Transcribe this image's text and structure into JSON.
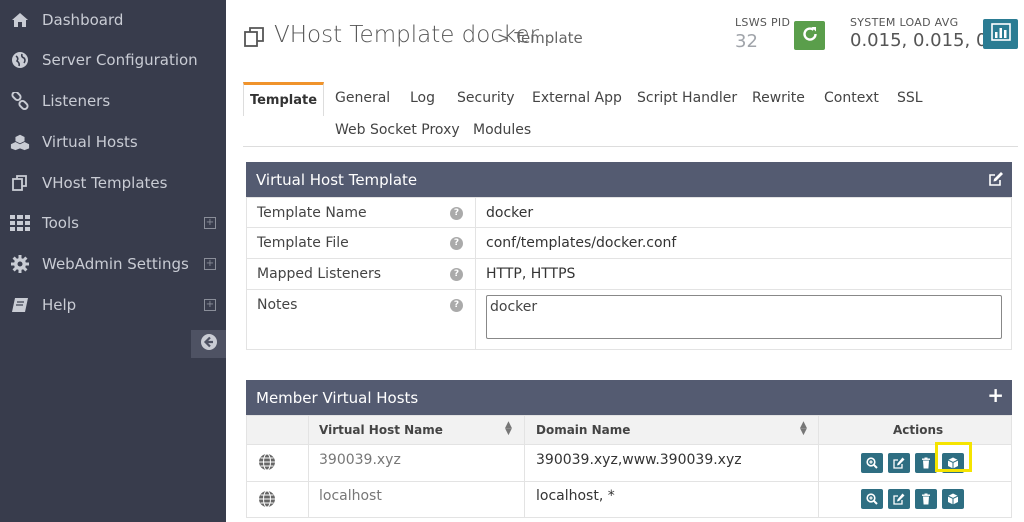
{
  "sidebar": {
    "items": [
      {
        "label": "Dashboard",
        "icon": "home-icon"
      },
      {
        "label": "Server Configuration",
        "icon": "globe-icon"
      },
      {
        "label": "Listeners",
        "icon": "link-icon"
      },
      {
        "label": "Virtual Hosts",
        "icon": "cubes-icon"
      },
      {
        "label": "VHost Templates",
        "icon": "copy-icon"
      },
      {
        "label": "Tools",
        "icon": "grid-icon",
        "expand": "+"
      },
      {
        "label": "WebAdmin Settings",
        "icon": "gear-icon",
        "expand": "+"
      },
      {
        "label": "Help",
        "icon": "book-icon",
        "expand": "+"
      }
    ]
  },
  "header": {
    "title": "VHost Template docker",
    "subtitle": "> Template",
    "pid_label": "LSWS PID",
    "pid_value": "32",
    "load_label": "SYSTEM LOAD AVG",
    "load_value": "0.015, 0.015, 0"
  },
  "tabs": {
    "active": "Template",
    "items": [
      "General",
      "Log",
      "Security",
      "External App",
      "Script Handler",
      "Rewrite",
      "Context",
      "SSL",
      "Web Socket Proxy",
      "Modules"
    ]
  },
  "template_panel": {
    "title": "Virtual Host Template",
    "rows": [
      {
        "key": "Template Name",
        "value": "docker"
      },
      {
        "key": "Template File",
        "value": "conf/templates/docker.conf"
      },
      {
        "key": "Mapped Listeners",
        "value": "HTTP, HTTPS"
      },
      {
        "key": "Notes",
        "value": "docker"
      }
    ],
    "help_glyph": "?"
  },
  "members_panel": {
    "title": "Member Virtual Hosts",
    "add_glyph": "+",
    "columns": [
      "Virtual Host Name",
      "Domain Name",
      "Actions"
    ],
    "rows": [
      {
        "name": "390039.xyz",
        "domain": "390039.xyz,www.390039.xyz"
      },
      {
        "name": "localhost",
        "domain": "localhost, *"
      }
    ]
  },
  "colors": {
    "sidebar_bg": "#383c4c",
    "panel_head": "#545b71",
    "accent_tab": "#f0932b",
    "restart": "#5a9e4b",
    "action_btn": "#2e6e82",
    "highlight": "#f5e400"
  }
}
